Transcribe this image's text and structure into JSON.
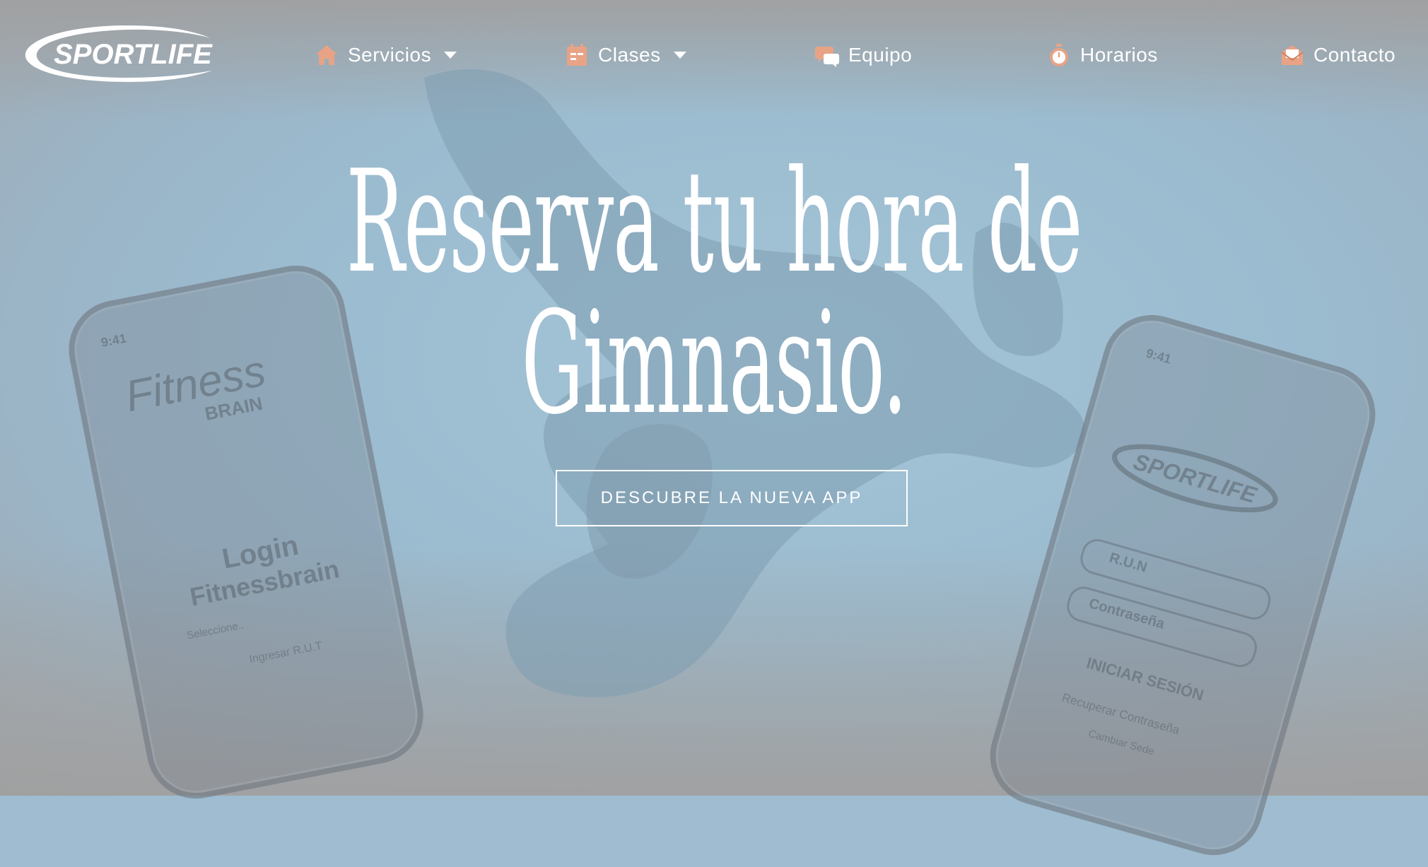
{
  "brand": {
    "logo_text": "SPORTLIFE"
  },
  "nav": {
    "items": [
      {
        "label": "Servicios",
        "icon": "home-icon",
        "has_dropdown": true
      },
      {
        "label": "Clases",
        "icon": "calendar-icon",
        "has_dropdown": true
      },
      {
        "label": "Equipo",
        "icon": "chat-bubbles-icon",
        "has_dropdown": false
      },
      {
        "label": "Horarios",
        "icon": "stopwatch-icon",
        "has_dropdown": false
      },
      {
        "label": "Contacto",
        "icon": "envelope-icon",
        "has_dropdown": false
      }
    ]
  },
  "hero": {
    "headline_line1": "Reserva tu hora de",
    "headline_line2": "Gimnasio.",
    "cta_label": "DESCUBRE LA NUEVA APP"
  },
  "phone_left": {
    "time": "9:41",
    "brand_line1": "Fitness",
    "brand_line2": "BRAIN",
    "login_line1": "Login",
    "login_line2": "Fitnessbrain",
    "select_placeholder": "Seleccione..",
    "run_placeholder": "Ingresar R.U.T"
  },
  "phone_right": {
    "time": "9:41",
    "logo_text": "SPORTLIFE",
    "run_field": "R.U.N",
    "password_field": "Contraseña",
    "login_button": "INICIAR SESIÓN",
    "recover_link": "Recuperar Contraseña",
    "change_link": "Cambiar Sede"
  },
  "colors": {
    "accent_icon": "#e8a386",
    "text": "#ffffff",
    "overlay_blue": "#9fbcd0",
    "overlay_gray": "#a0a0a0"
  }
}
